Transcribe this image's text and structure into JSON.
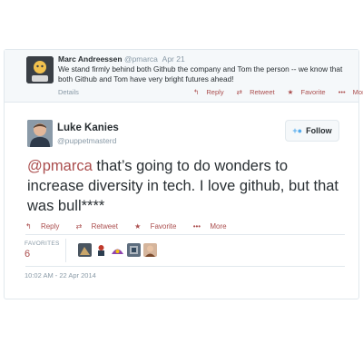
{
  "parent_tweet": {
    "author_name": "Marc Andreessen",
    "author_handle": "@pmarca",
    "date": "Apr 21",
    "text": "We stand firmly behind both Github the company and Tom the person -- we know that both Github and Tom have very bright futures ahead!",
    "details_label": "Details",
    "actions": {
      "reply": "Reply",
      "retweet": "Retweet",
      "favorite": "Favorite",
      "more": "More"
    }
  },
  "tweet": {
    "author_name": "Luke Kanies",
    "author_handle": "@puppetmasterd",
    "follow_label": "Follow",
    "mention": "@pmarca",
    "text": " that’s going to do wonders to increase diversity in tech. I love github, but that was bull****",
    "actions": {
      "reply": "Reply",
      "retweet": "Retweet",
      "favorite": "Favorite",
      "more": "More"
    },
    "favorites_label": "FAVORITES",
    "favorites_count": "6",
    "timestamp": "10:02 AM - 22 Apr 2014"
  },
  "colors": {
    "accent": "#ab4e4e",
    "muted": "#8899a6",
    "follow_icon": "#55acee"
  }
}
